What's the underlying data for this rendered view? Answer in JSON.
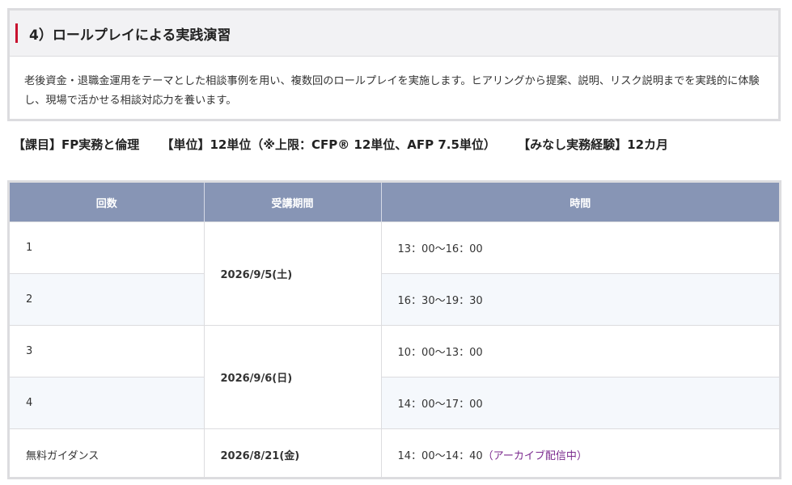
{
  "section": {
    "title": "4）ロールプレイによる実践演習",
    "description": "老後資金・退職金運用をテーマとした相談事例を用い、複数回のロールプレイを実施します。ヒアリングから提案、説明、リスク説明までを実践的に体験し、現場で活かせる相談対応力を養います。"
  },
  "summary": {
    "subject": "【課目】FP実務と倫理",
    "credits": "【単位】12単位（※上限：CFP® 12単位、AFP 7.5単位）",
    "experience": "【みなし実務経験】12カ月"
  },
  "table": {
    "headers": [
      "回数",
      "受講期間",
      "時間"
    ],
    "rows": [
      {
        "no": "1",
        "date": "2026/9/5(土)",
        "time": "13：00〜16：00"
      },
      {
        "no": "2",
        "time": "16：30〜19：30"
      },
      {
        "no": "3",
        "date": "2026/9/6(日)",
        "time": "10：00〜13：00"
      },
      {
        "no": "4",
        "time": "14：00〜17：00"
      },
      {
        "no": "無料ガイダンス",
        "date": "2026/8/21(金)",
        "time": "14：00〜14：40",
        "note": "（アーカイブ配信中）"
      }
    ]
  },
  "colors": {
    "accent": "#c8102e",
    "header_bg": "#8795b5",
    "archive_link": "#7b2a8e"
  }
}
